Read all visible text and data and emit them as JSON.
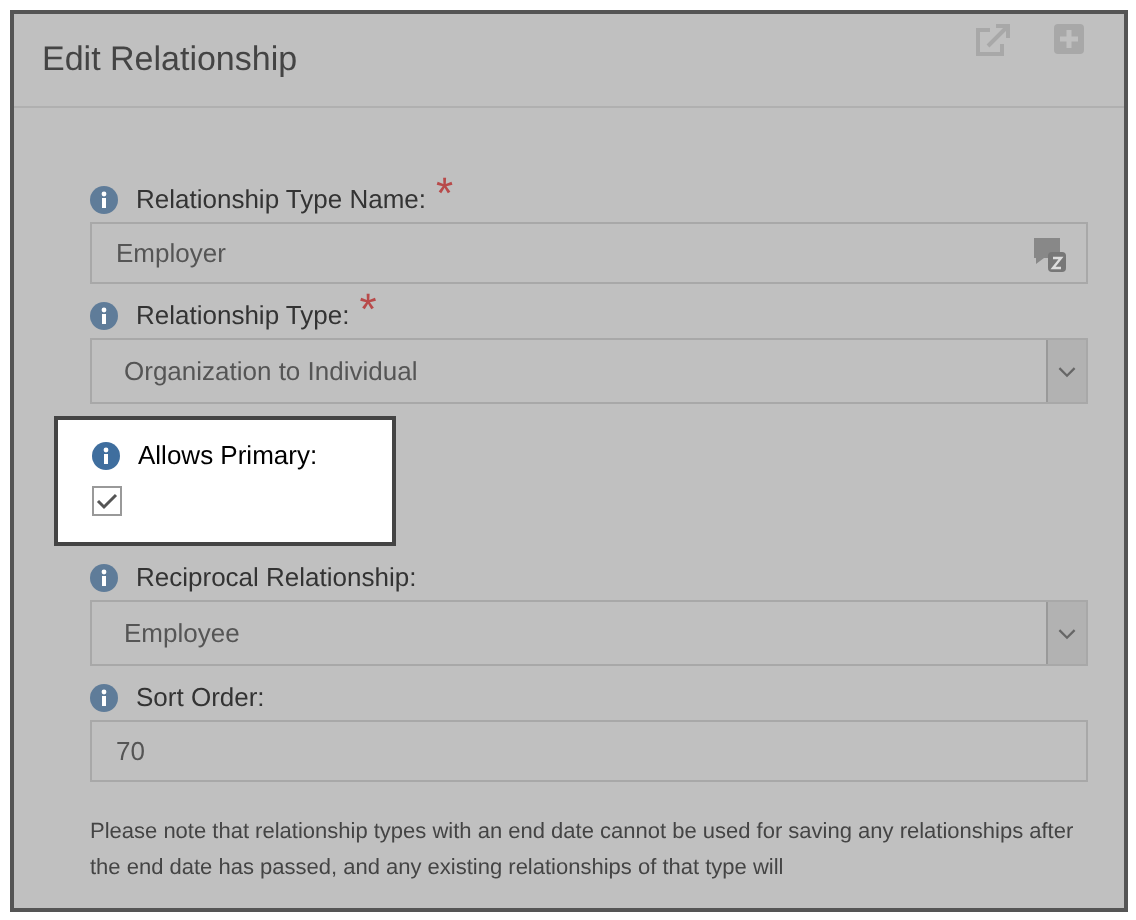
{
  "panel": {
    "title": "Edit Relationship"
  },
  "fields": [
    {
      "kind": "text",
      "label": "Relationship Type Name:",
      "required_mark": "*",
      "value": "Employer",
      "highlighted": false,
      "translate_icon": true
    },
    {
      "kind": "select",
      "label": "Relationship Type:",
      "required_mark": "*",
      "value": "Organization to Individual",
      "highlighted": false
    },
    {
      "kind": "checkbox",
      "label": "Allows Primary:",
      "checked": true,
      "highlighted": true
    },
    {
      "kind": "select",
      "label": "Reciprocal Relationship:",
      "value": "Employee",
      "highlighted": false
    },
    {
      "kind": "text",
      "label": "Sort Order:",
      "value": "70",
      "highlighted": false,
      "translate_icon": false
    }
  ],
  "note": "Please note that relationship types with an end date cannot be used for saving any relationships after the end date has passed, and any existing relationships of that type will"
}
